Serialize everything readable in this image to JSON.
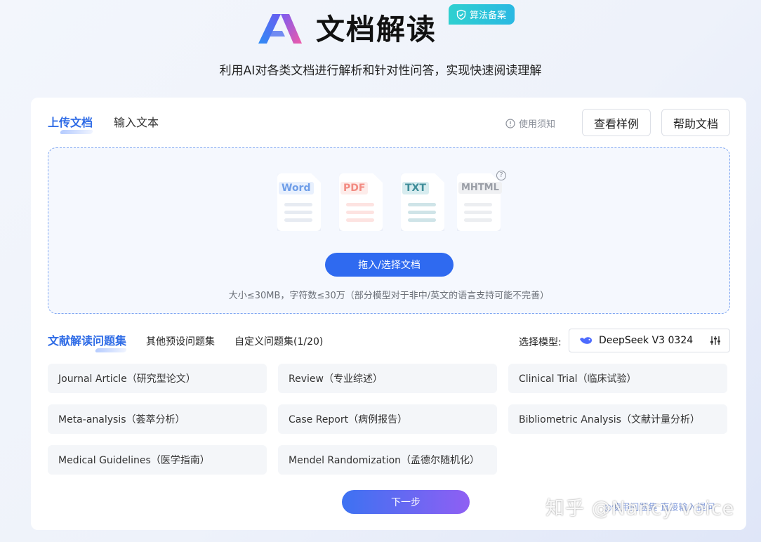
{
  "header": {
    "title": "文档解读",
    "badge": "算法备案",
    "subtitle": "利用AI对各类文档进行解析和针对性问答，实现快速阅读理解"
  },
  "top_tabs": [
    {
      "label": "上传文档",
      "active": true
    },
    {
      "label": "输入文本",
      "active": false
    }
  ],
  "notice_label": "使用须知",
  "buttons": {
    "sample": "查看样例",
    "help": "帮助文档",
    "upload": "拖入/选择文档",
    "next": "下一步"
  },
  "file_types": [
    "Word",
    "PDF",
    "TXT",
    "MHTML"
  ],
  "file_type_help": "?",
  "upload_limit": "大小≤30MB，字符数≤30万（部分模型对于非中/英文的语言支持可能不完善）",
  "question_tabs": [
    {
      "label": "文献解读问题集",
      "active": true
    },
    {
      "label": "其他预设问题集",
      "active": false
    },
    {
      "label": "自定义问题集(1/20)",
      "active": false
    }
  ],
  "model": {
    "label": "选择模型:",
    "value": "DeepSeek V3 0324"
  },
  "question_sets": [
    "Journal Article（研究型论文）",
    "Review（专业综述）",
    "Clinical Trial（临床试验）",
    "Meta-analysis（荟萃分析）",
    "Case Report（病例报告）",
    "Bibliometric Analysis（文献计量分析）",
    "Medical Guidelines（医学指南）",
    "Mendel Randomization（孟德尔随机化）"
  ],
  "watermark": "知乎 @Nancy voice",
  "partial_link": "◎使用问题集  直接输入提问",
  "colors": {
    "accent": "#2f6af0",
    "badge": "#2ab8e2",
    "next_gradient_end": "#8f5ff3"
  }
}
